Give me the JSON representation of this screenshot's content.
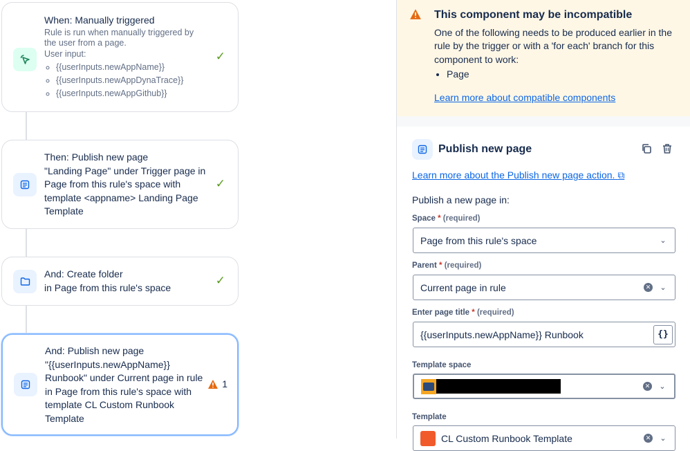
{
  "flow": {
    "cards": [
      {
        "title": "When: Manually triggered",
        "desc": "Rule is run when manually triggered by the user from a page.",
        "input_label": "User input:",
        "inputs": [
          "{{userInputs.newAppName}}",
          "{{userInputs.newAppDynaTrace}}",
          "{{userInputs.newAppGithub}}"
        ],
        "status": "success"
      },
      {
        "title": "Then: Publish new page",
        "desc": "\"Landing Page\" under Trigger page in Page from this rule's space with template <appname> Landing Page Template",
        "status": "success"
      },
      {
        "title": "And: Create folder",
        "desc": "in Page from this rule's space",
        "status": "success"
      },
      {
        "title": "And: Publish new page",
        "desc": "\"{{userInputs.newAppName}} Runbook\" under Current page in rule in Page from this rule's space with template CL Custom Runbook Template",
        "status": "warning",
        "warning_count": "1"
      }
    ]
  },
  "banner": {
    "title": "This component may be incompatible",
    "body": "One of the following needs to be produced earlier in the rule by the trigger or with a 'for each' branch for this component to work:",
    "items": [
      "Page"
    ],
    "link": "Learn more about compatible components"
  },
  "panel": {
    "title": "Publish new page",
    "learn_link": "Learn more about the Publish new page action.",
    "intro": "Publish a new page in:",
    "fields": {
      "space": {
        "label": "Space",
        "req": "*",
        "req_text": "(required)",
        "value": "Page from this rule's space"
      },
      "parent": {
        "label": "Parent",
        "req": "*",
        "req_text": "(required)",
        "value": "Current page in rule"
      },
      "title": {
        "label": "Enter page title",
        "req": "*",
        "req_text": "(required)",
        "value": "{{userInputs.newAppName}} Runbook",
        "brace": "{}"
      },
      "template_space": {
        "label": "Template space",
        "value": ""
      },
      "template": {
        "label": "Template",
        "value": "CL Custom Runbook Template"
      }
    }
  }
}
